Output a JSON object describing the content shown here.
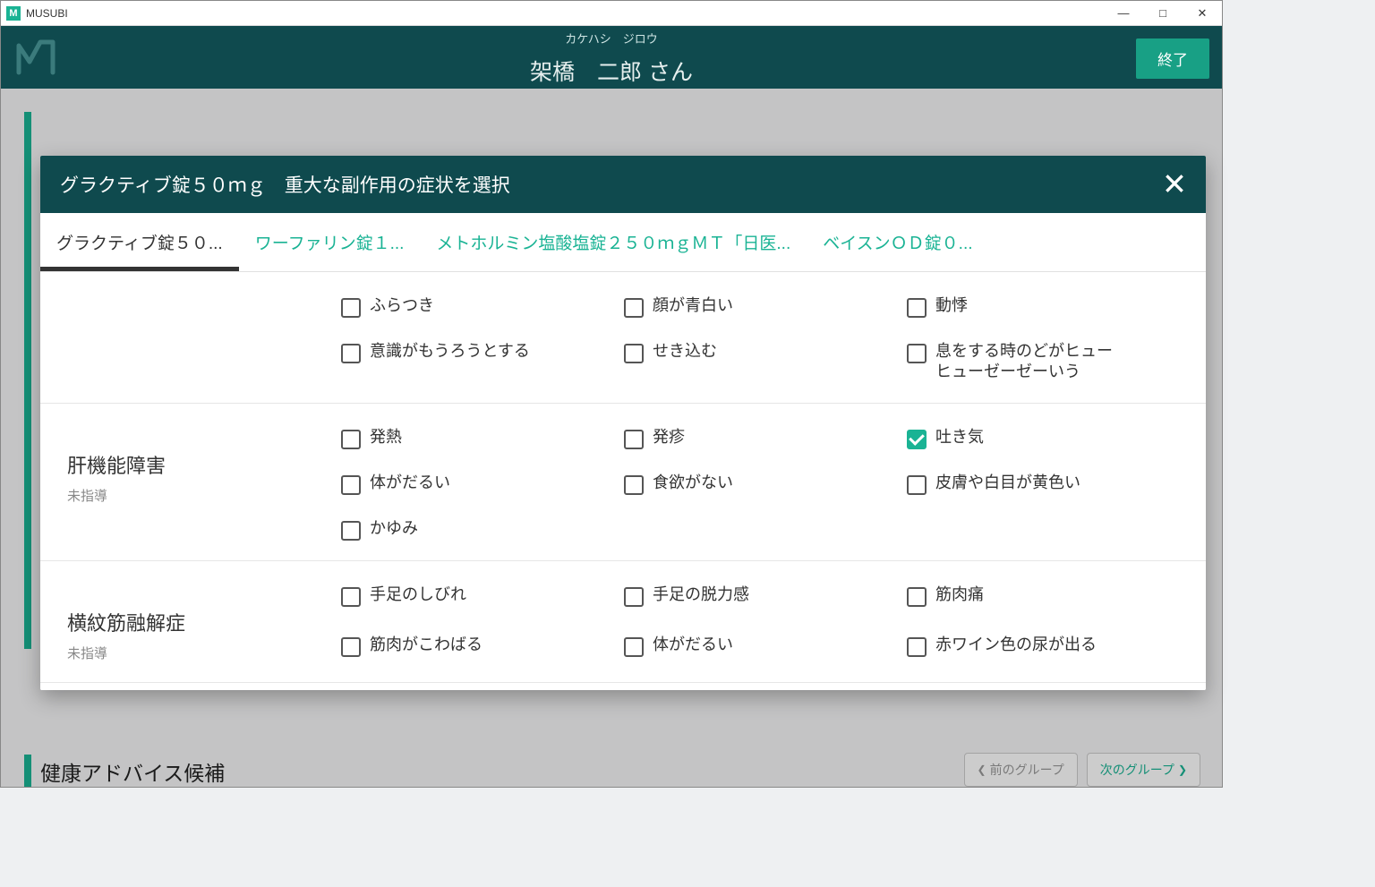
{
  "window": {
    "title": "MUSUBI"
  },
  "header": {
    "patient_ruby": "カケハシ　ジロウ",
    "patient_name": "架橋　二郎 さん",
    "end_button": "終了"
  },
  "background": {
    "advice_title": "健康アドバイス候補",
    "prev_group": "前のグループ",
    "next_group": "次のグループ"
  },
  "modal": {
    "title": "グラクティブ錠５０ｍｇ　重大な副作用の症状を選択",
    "tabs": [
      {
        "label": "グラクティブ錠５０...",
        "active": true
      },
      {
        "label": "ワーファリン錠１...",
        "active": false
      },
      {
        "label": "メトホルミン塩酸塩錠２５０ｍｇＭＴ「日医...",
        "active": false
      },
      {
        "label": "ベイスンＯＤ錠０...",
        "active": false
      }
    ],
    "sections": [
      {
        "name": "",
        "sub": "",
        "items": [
          {
            "label": "ふらつき",
            "checked": false
          },
          {
            "label": "顔が青白い",
            "checked": false
          },
          {
            "label": "動悸",
            "checked": false
          },
          {
            "label": "意識がもうろうとする",
            "checked": false
          },
          {
            "label": "せき込む",
            "checked": false
          },
          {
            "label": "息をする時のどがヒューヒューゼーゼーいう",
            "checked": false
          }
        ]
      },
      {
        "name": "肝機能障害",
        "sub": "未指導",
        "items": [
          {
            "label": "発熱",
            "checked": false
          },
          {
            "label": "発疹",
            "checked": false
          },
          {
            "label": "吐き気",
            "checked": true
          },
          {
            "label": "体がだるい",
            "checked": false
          },
          {
            "label": "食欲がない",
            "checked": false
          },
          {
            "label": "皮膚や白目が黄色い",
            "checked": false
          },
          {
            "label": "かゆみ",
            "checked": false
          }
        ]
      },
      {
        "name": "横紋筋融解症",
        "sub": "未指導",
        "items": [
          {
            "label": "手足のしびれ",
            "checked": false
          },
          {
            "label": "手足の脱力感",
            "checked": false
          },
          {
            "label": "筋肉痛",
            "checked": false
          },
          {
            "label": "筋肉がこわばる",
            "checked": false
          },
          {
            "label": "体がだるい",
            "checked": false
          },
          {
            "label": "赤ワイン色の尿が出る",
            "checked": false
          }
        ]
      }
    ]
  }
}
